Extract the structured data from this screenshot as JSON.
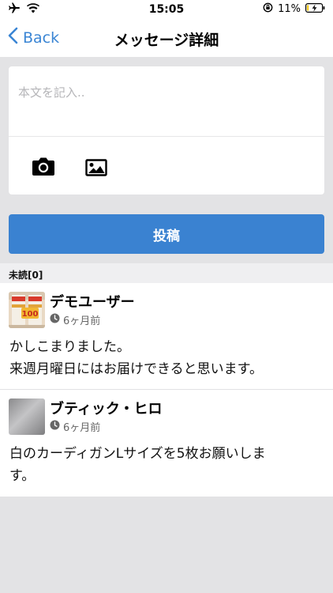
{
  "status_bar": {
    "time": "15:05",
    "battery_percent": "11%",
    "battery_level": 0.11,
    "icons": [
      "airplane-icon",
      "wifi-icon",
      "rotation-lock-icon",
      "battery-icon"
    ]
  },
  "nav": {
    "back_label": "Back",
    "title": "メッセージ詳細"
  },
  "compose": {
    "placeholder": "本文を記入..",
    "value": "",
    "icons": [
      "camera-icon",
      "image-icon"
    ]
  },
  "post_button": "投稿",
  "section": {
    "label": "未読[0]"
  },
  "messages": [
    {
      "sender": "デモユーザー",
      "time": "6ヶ月前",
      "body": "かしこまりました。\n来週月曜日にはお届けできると思います。",
      "avatar": "product-thumbnail"
    },
    {
      "sender": "ブティック・ヒロ",
      "time": "6ヶ月前",
      "body": "白のカーディガンLサイズを5枚お願いしま\nす。",
      "avatar": "gray-thumbnail"
    }
  ],
  "colors": {
    "accent": "#3a82d1",
    "background": "#e3e3e5",
    "section_header": "#efeff1"
  }
}
